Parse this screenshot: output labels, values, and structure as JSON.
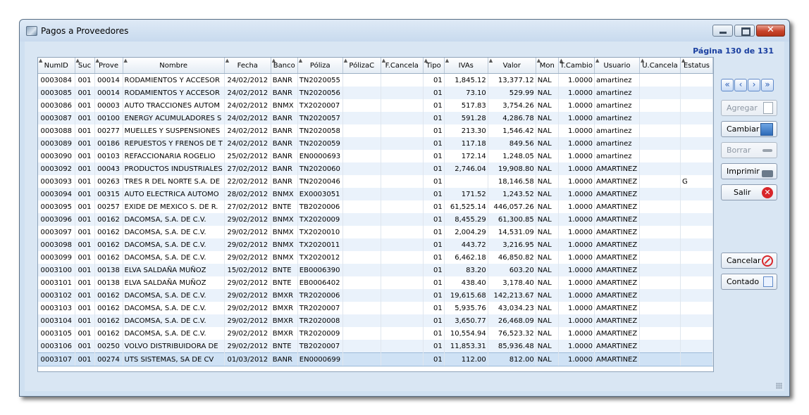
{
  "window": {
    "title": "Pagos a Proveedores",
    "icon": "app-window-icon"
  },
  "pager": {
    "label": "Página 130 de 131"
  },
  "columns": [
    "NumID",
    "Suc",
    "Prove",
    "Nombre",
    "Fecha",
    "Banco",
    "Póliza",
    "PólizaC",
    "F.Cancela",
    "Tipo",
    "IVAs",
    "Valor",
    "Mon",
    "T.Cambio",
    "Usuario",
    "U.Cancela",
    "Estatus"
  ],
  "rows": [
    [
      "0003084",
      "001",
      "00014",
      "RODAMIENTOS Y ACCESOR",
      "24/02/2012",
      "BANR",
      "TN2020055",
      "",
      "",
      "01",
      "1,845.12",
      "13,377.12",
      "NAL",
      "1.0000",
      "amartinez",
      "",
      ""
    ],
    [
      "0003085",
      "001",
      "00014",
      "RODAMIENTOS Y ACCESOR",
      "24/02/2012",
      "BANR",
      "TN2020056",
      "",
      "",
      "01",
      "73.10",
      "529.99",
      "NAL",
      "1.0000",
      "amartinez",
      "",
      ""
    ],
    [
      "0003086",
      "001",
      "00003",
      "AUTO TRACCIONES AUTOM",
      "24/02/2012",
      "BNMX",
      "TX2020007",
      "",
      "",
      "01",
      "517.83",
      "3,754.26",
      "NAL",
      "1.0000",
      "amartinez",
      "",
      ""
    ],
    [
      "0003087",
      "001",
      "00100",
      "ENERGY ACUMULADORES S",
      "24/02/2012",
      "BANR",
      "TN2020057",
      "",
      "",
      "01",
      "591.28",
      "4,286.78",
      "NAL",
      "1.0000",
      "amartinez",
      "",
      ""
    ],
    [
      "0003088",
      "001",
      "00277",
      "MUELLES Y SUSPENSIONES",
      "24/02/2012",
      "BANR",
      "TN2020058",
      "",
      "",
      "01",
      "213.30",
      "1,546.42",
      "NAL",
      "1.0000",
      "amartinez",
      "",
      ""
    ],
    [
      "0003089",
      "001",
      "00186",
      "REPUESTOS Y FRENOS DE T",
      "24/02/2012",
      "BANR",
      "TN2020059",
      "",
      "",
      "01",
      "117.18",
      "849.56",
      "NAL",
      "1.0000",
      "amartinez",
      "",
      ""
    ],
    [
      "0003090",
      "001",
      "00103",
      "REFACCIONARIA ROGELIO",
      "25/02/2012",
      "BANR",
      "EN0000693",
      "",
      "",
      "01",
      "172.14",
      "1,248.05",
      "NAL",
      "1.0000",
      "amartinez",
      "",
      ""
    ],
    [
      "0003092",
      "001",
      "00043",
      "PRODUCTOS INDUSTRIALES",
      "27/02/2012",
      "BANR",
      "TN2020060",
      "",
      "",
      "01",
      "2,746.04",
      "19,908.80",
      "NAL",
      "1.0000",
      "AMARTINEZ",
      "",
      ""
    ],
    [
      "0003093",
      "001",
      "00263",
      "TRES R DEL NORTE S.A. DE",
      "22/02/2012",
      "BANR",
      "TN2020046",
      "",
      "",
      "01",
      "",
      "18,146.58",
      "NAL",
      "1.0000",
      "AMARTINEZ",
      "",
      "G"
    ],
    [
      "0003094",
      "001",
      "00315",
      "AUTO ELECTRICA AUTOMO",
      "28/02/2012",
      "BNMX",
      "EX0003051",
      "",
      "",
      "01",
      "171.52",
      "1,243.52",
      "NAL",
      "1.0000",
      "AMARTINEZ",
      "",
      ""
    ],
    [
      "0003095",
      "001",
      "00257",
      "EXIDE DE MEXICO S. DE R.",
      "27/02/2012",
      "BNTE",
      "TB2020006",
      "",
      "",
      "01",
      "61,525.14",
      "446,057.26",
      "NAL",
      "1.0000",
      "AMARTINEZ",
      "",
      ""
    ],
    [
      "0003096",
      "001",
      "00162",
      "DACOMSA, S.A. DE C.V.",
      "29/02/2012",
      "BNMX",
      "TX2020009",
      "",
      "",
      "01",
      "8,455.29",
      "61,300.85",
      "NAL",
      "1.0000",
      "AMARTINEZ",
      "",
      ""
    ],
    [
      "0003097",
      "001",
      "00162",
      "DACOMSA, S.A. DE C.V.",
      "29/02/2012",
      "BNMX",
      "TX2020010",
      "",
      "",
      "01",
      "2,004.29",
      "14,531.09",
      "NAL",
      "1.0000",
      "AMARTINEZ",
      "",
      ""
    ],
    [
      "0003098",
      "001",
      "00162",
      "DACOMSA, S.A. DE C.V.",
      "29/02/2012",
      "BNMX",
      "TX2020011",
      "",
      "",
      "01",
      "443.72",
      "3,216.95",
      "NAL",
      "1.0000",
      "AMARTINEZ",
      "",
      ""
    ],
    [
      "0003099",
      "001",
      "00162",
      "DACOMSA, S.A. DE C.V.",
      "29/02/2012",
      "BNMX",
      "TX2020012",
      "",
      "",
      "01",
      "6,462.18",
      "46,850.82",
      "NAL",
      "1.0000",
      "AMARTINEZ",
      "",
      ""
    ],
    [
      "0003100",
      "001",
      "00138",
      "ELVA SALDAÑA MUÑOZ",
      "15/02/2012",
      "BNTE",
      "EB0006390",
      "",
      "",
      "01",
      "83.20",
      "603.20",
      "NAL",
      "1.0000",
      "AMARTINEZ",
      "",
      ""
    ],
    [
      "0003101",
      "001",
      "00138",
      "ELVA SALDAÑA MUÑOZ",
      "29/02/2012",
      "BNTE",
      "EB0006402",
      "",
      "",
      "01",
      "438.40",
      "3,178.40",
      "NAL",
      "1.0000",
      "AMARTINEZ",
      "",
      ""
    ],
    [
      "0003102",
      "001",
      "00162",
      "DACOMSA, S.A. DE C.V.",
      "29/02/2012",
      "BMXR",
      "TR2020006",
      "",
      "",
      "01",
      "19,615.68",
      "142,213.67",
      "NAL",
      "1.0000",
      "AMARTINEZ",
      "",
      ""
    ],
    [
      "0003103",
      "001",
      "00162",
      "DACOMSA, S.A. DE C.V.",
      "29/02/2012",
      "BMXR",
      "TR2020007",
      "",
      "",
      "01",
      "5,935.76",
      "43,034.23",
      "NAL",
      "1.0000",
      "AMARTINEZ",
      "",
      ""
    ],
    [
      "0003104",
      "001",
      "00162",
      "DACOMSA, S.A. DE C.V.",
      "29/02/2012",
      "BMXR",
      "TR2020008",
      "",
      "",
      "01",
      "3,650.77",
      "26,468.09",
      "NAL",
      "1.0000",
      "AMARTINEZ",
      "",
      ""
    ],
    [
      "0003105",
      "001",
      "00162",
      "DACOMSA, S.A. DE C.V.",
      "29/02/2012",
      "BMXR",
      "TR2020009",
      "",
      "",
      "01",
      "10,554.94",
      "76,523.32",
      "NAL",
      "1.0000",
      "AMARTINEZ",
      "",
      ""
    ],
    [
      "0003106",
      "001",
      "00250",
      "VOLVO DISTRIBUIDORA DE",
      "29/02/2012",
      "BNTE",
      "TB2020007",
      "",
      "",
      "01",
      "11,853.31",
      "85,936.48",
      "NAL",
      "1.0000",
      "AMARTINEZ",
      "",
      ""
    ],
    [
      "0003107",
      "001",
      "00274",
      "UTS SISTEMAS, SA DE CV",
      "01/03/2012",
      "BANR",
      "EN0000699",
      "",
      "",
      "01",
      "112.00",
      "812.00",
      "NAL",
      "1.0000",
      "AMARTINEZ",
      "",
      ""
    ]
  ],
  "selected_row": 22,
  "nav": {
    "first": "«",
    "prev": "‹",
    "next": "›",
    "last": "»"
  },
  "buttons": {
    "agregar": "Agregar",
    "cambiar": "Cambiar",
    "borrar": "Borrar",
    "imprimir": "Imprimir",
    "salir": "Salir",
    "cancelar": "Cancelar",
    "contado": "Contado"
  },
  "colors": {
    "selected_row": "#cfe2f5",
    "alt_row": "#eaf2fb",
    "accent": "#1a3fa0"
  }
}
